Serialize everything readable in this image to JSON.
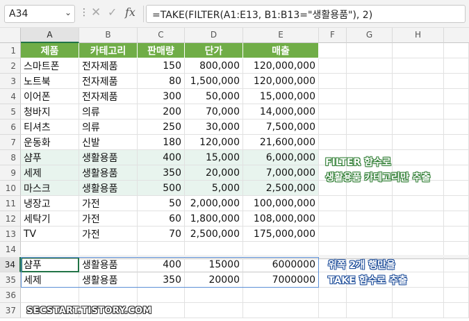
{
  "formula_bar": {
    "name_box": "A34",
    "name_box_caret": "⌄",
    "dots": "⋮",
    "cancel_glyph": "✕",
    "enter_glyph": "✓",
    "fx_label": "fx",
    "formula": "=TAKE(FILTER(A1:E13, B1:B13=\"생활용품\"), 2)"
  },
  "columns": [
    "A",
    "B",
    "C",
    "D",
    "E",
    "F",
    "G",
    "H"
  ],
  "header_row": {
    "num": "1",
    "cells": [
      "제품",
      "카테고리",
      "판매량",
      "단가",
      "매출"
    ]
  },
  "rows": [
    {
      "num": "2",
      "cells": [
        "스마트폰",
        "전자제품",
        "150",
        "800,000",
        "120,000,000"
      ]
    },
    {
      "num": "3",
      "cells": [
        "노트북",
        "전자제품",
        "80",
        "1,500,000",
        "120,000,000"
      ]
    },
    {
      "num": "4",
      "cells": [
        "이어폰",
        "전자제품",
        "300",
        "50,000",
        "15,000,000"
      ]
    },
    {
      "num": "5",
      "cells": [
        "청바지",
        "의류",
        "200",
        "70,000",
        "14,000,000"
      ]
    },
    {
      "num": "6",
      "cells": [
        "티셔츠",
        "의류",
        "250",
        "30,000",
        "7,500,000"
      ]
    },
    {
      "num": "7",
      "cells": [
        "운동화",
        "신발",
        "180",
        "120,000",
        "21,600,000"
      ]
    },
    {
      "num": "8",
      "cells": [
        "샴푸",
        "생활용품",
        "400",
        "15,000",
        "6,000,000"
      ]
    },
    {
      "num": "9",
      "cells": [
        "세제",
        "생활용품",
        "350",
        "20,000",
        "7,000,000"
      ]
    },
    {
      "num": "10",
      "cells": [
        "마스크",
        "생활용품",
        "500",
        "5,000",
        "2,500,000"
      ]
    },
    {
      "num": "11",
      "cells": [
        "냉장고",
        "가전",
        "50",
        "2,000,000",
        "100,000,000"
      ]
    },
    {
      "num": "12",
      "cells": [
        "세탁기",
        "가전",
        "60",
        "1,800,000",
        "108,000,000"
      ]
    },
    {
      "num": "13",
      "cells": [
        "TV",
        "가전",
        "70",
        "2,500,000",
        "175,000,000"
      ]
    },
    {
      "num": "14",
      "cells": [
        "",
        "",
        "",
        "",
        ""
      ]
    }
  ],
  "result_rows": [
    {
      "num": "34",
      "cells": [
        "샴푸",
        "생활용품",
        "400",
        "15000",
        "6000000"
      ]
    },
    {
      "num": "35",
      "cells": [
        "세제",
        "생활용품",
        "350",
        "20000",
        "7000000"
      ]
    },
    {
      "num": "36",
      "cells": [
        "",
        "",
        "",
        "",
        ""
      ]
    },
    {
      "num": "37",
      "cells": [
        "",
        "",
        "",
        "",
        ""
      ]
    }
  ],
  "annotations": {
    "filter_line1": "FILTER 함수로",
    "filter_line2": "생활용품 카테고리만 추출",
    "take_line1": "위쪽 2개 행만을",
    "take_line2": "TAKE 함수로 추출"
  },
  "watermark": "SECSTART.TISTORY.COM",
  "colors": {
    "header_green": "#70ad47",
    "highlight_rows": "#e8f4ee",
    "selection": "#217346",
    "result_border": "#5b8fd6"
  }
}
